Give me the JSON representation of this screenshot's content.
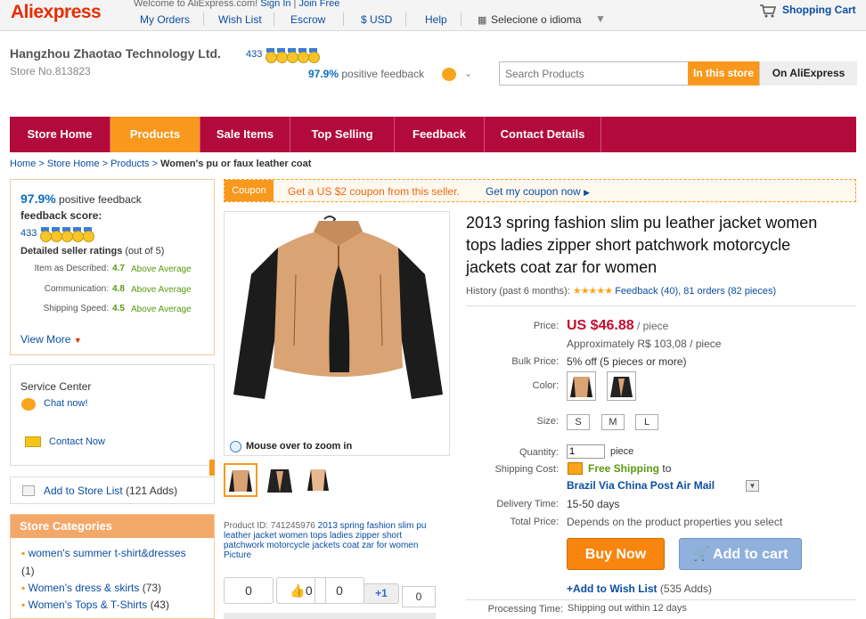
{
  "header": {
    "logo_a": "Ali",
    "logo_b": "express",
    "welcome": "Welcome to AliExpress.com!",
    "sign_in": "Sign In",
    "join_free": "Join Free",
    "nav": [
      "My Orders",
      "Wish List",
      "Escrow",
      "$ USD",
      "Help",
      "Selecione o idioma"
    ],
    "cart": "Shopping Cart"
  },
  "store": {
    "name": "Hangzhou Zhaotao Technology Ltd.",
    "number": "Store No.813823",
    "score": "433",
    "positive_pct": "97.9%",
    "positive_label": "positive feedback"
  },
  "search": {
    "placeholder": "Search Products",
    "in_store": "In this store",
    "on_ali": "On AliExpress"
  },
  "nav": [
    "Store Home",
    "Products",
    "Sale Items",
    "Top Selling",
    "Feedback",
    "Contact Details"
  ],
  "breadcrumb": [
    "Home",
    "Store Home",
    "Products",
    "Women's pu or faux leather coat"
  ],
  "sidebar": {
    "pct": "97.9%",
    "positive": "positive feedback",
    "fb_score": "feedback score:",
    "score": "433",
    "detailed": "Detailed seller ratings",
    "outof": "(out of 5)",
    "ratings": [
      {
        "label": "Item as Described:",
        "value": "4.7",
        "note": "Above Average"
      },
      {
        "label": "Communication:",
        "value": "4.8",
        "note": "Above Average"
      },
      {
        "label": "Shipping Speed:",
        "value": "4.5",
        "note": "Above Average"
      }
    ],
    "view_more": "View More",
    "service": "Service Center",
    "chat": "Chat now!",
    "contact": "Contact Now",
    "add_list": "Add to Store List",
    "adds": "(121 Adds)",
    "categories_title": "Store Categories",
    "categories": [
      {
        "name": "women's summer t-shirt&dresses",
        "count": "(1)"
      },
      {
        "name": "Women's dress & skirts",
        "count": "(73)"
      },
      {
        "name": "Women's Tops & T-Shirts",
        "count": "(43)"
      }
    ]
  },
  "coupon": {
    "tag": "Coupon",
    "text": "Get a US $2 coupon from this seller.",
    "link": "Get my coupon now"
  },
  "product": {
    "title": "2013 spring fashion slim pu leather jacket women tops ladies zipper short patchwork motorcycle jackets coat zar for women",
    "history": "History (past 6 months):",
    "feedback": "Feedback (40),",
    "orders": "81 orders (82 pieces)",
    "zoom": "Mouse over to zoom in",
    "id_label": "Product ID: 741245976",
    "id_desc": "2013 spring fashion slim pu leather jacket women tops ladies zipper short patchwork motorcycle jackets coat zar for women Picture",
    "price_label": "Price:",
    "price": "US $46.88",
    "per": "/ piece",
    "approx": "Approximately R$ 103,08 / piece",
    "bulk_label": "Bulk Price:",
    "bulk": "5% off (5 pieces or more)",
    "color_label": "Color:",
    "size_label": "Size:",
    "sizes": [
      "S",
      "M",
      "L"
    ],
    "qty_label": "Quantity:",
    "qty": "1",
    "qty_unit": "piece",
    "ship_label": "Shipping Cost:",
    "free_ship": "Free Shipping",
    "to": "to",
    "ship_method": "Brazil Via China Post Air Mail",
    "delivery_label": "Delivery Time:",
    "delivery": "15-50 days",
    "total_label": "Total Price:",
    "total": "Depends on the product properties you select",
    "buy": "Buy Now",
    "add_cart": "Add to cart",
    "wish": "+Add to Wish List",
    "wish_count": "(535 Adds)",
    "processing_label": "Processing Time:",
    "processing": "Shipping out within 12 days"
  },
  "social": {
    "c1": "0",
    "c2": "0",
    "c3": "0",
    "plus": "+1",
    "c4": "0"
  }
}
